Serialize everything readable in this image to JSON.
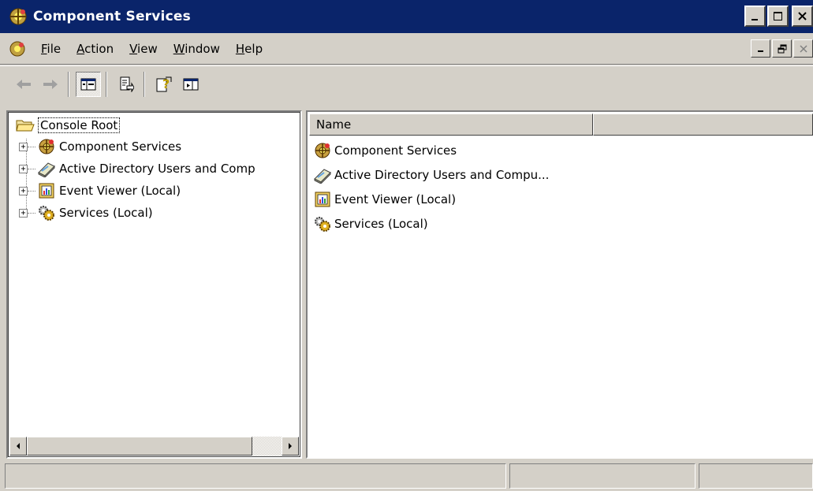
{
  "window": {
    "title": "Component Services",
    "icon": "component-services-icon"
  },
  "menu": [
    {
      "label_pre": "",
      "label_ul": "F",
      "label_post": "ile"
    },
    {
      "label_pre": "",
      "label_ul": "A",
      "label_post": "ction"
    },
    {
      "label_pre": "",
      "label_ul": "V",
      "label_post": "iew"
    },
    {
      "label_pre": "",
      "label_ul": "W",
      "label_post": "indow"
    },
    {
      "label_pre": "",
      "label_ul": "H",
      "label_post": "elp"
    }
  ],
  "toolbar": {
    "buttons": [
      "back-arrow-icon",
      "forward-arrow-icon",
      "show-hide-console-tree-icon",
      "export-list-icon",
      "help-icon",
      "show-hide-action-pane-icon"
    ]
  },
  "tree": {
    "root_label": "Console Root",
    "items": [
      {
        "label": "Component Services",
        "icon": "component-services-icon",
        "expander": "+"
      },
      {
        "label": "Active Directory Users and Comp",
        "icon": "active-directory-icon",
        "expander": "+"
      },
      {
        "label": "Event Viewer (Local)",
        "icon": "event-viewer-icon",
        "expander": "+"
      },
      {
        "label": "Services (Local)",
        "icon": "services-gears-icon",
        "expander": "+"
      }
    ]
  },
  "list": {
    "columns": [
      "Name",
      ""
    ],
    "items": [
      {
        "label": "Component Services",
        "icon": "component-services-icon"
      },
      {
        "label": "Active Directory Users and Compu...",
        "icon": "active-directory-icon"
      },
      {
        "label": "Event Viewer (Local)",
        "icon": "event-viewer-icon"
      },
      {
        "label": "Services (Local)",
        "icon": "services-gears-icon"
      }
    ]
  },
  "status": {
    "panels": [
      "",
      "",
      ""
    ]
  },
  "colors": {
    "title_bar": "#0a246a",
    "face": "#d4d0c8",
    "window_bg": "#ffffff"
  }
}
